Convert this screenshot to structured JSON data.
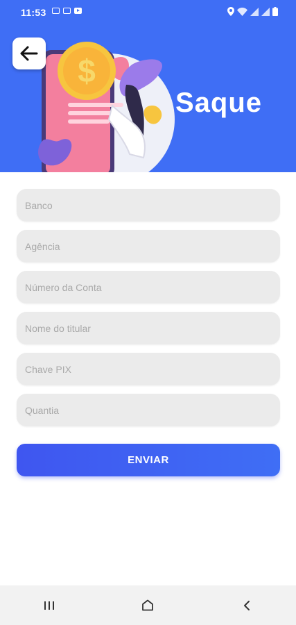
{
  "status_bar": {
    "time": "11:53"
  },
  "header": {
    "title": "Saque",
    "background_color": "#3f6ef5"
  },
  "form": {
    "fields": [
      {
        "placeholder": "Banco"
      },
      {
        "placeholder": "Agência"
      },
      {
        "placeholder": "Número da Conta"
      },
      {
        "placeholder": "Nome do titular"
      },
      {
        "placeholder": "Chave PIX"
      },
      {
        "placeholder": "Quantia"
      }
    ],
    "submit_label": "ENVIAR"
  },
  "icons": {
    "back": "arrow-left-icon",
    "nav_recent": "recent-apps-icon",
    "nav_home": "home-icon",
    "nav_back": "chevron-left-icon"
  }
}
